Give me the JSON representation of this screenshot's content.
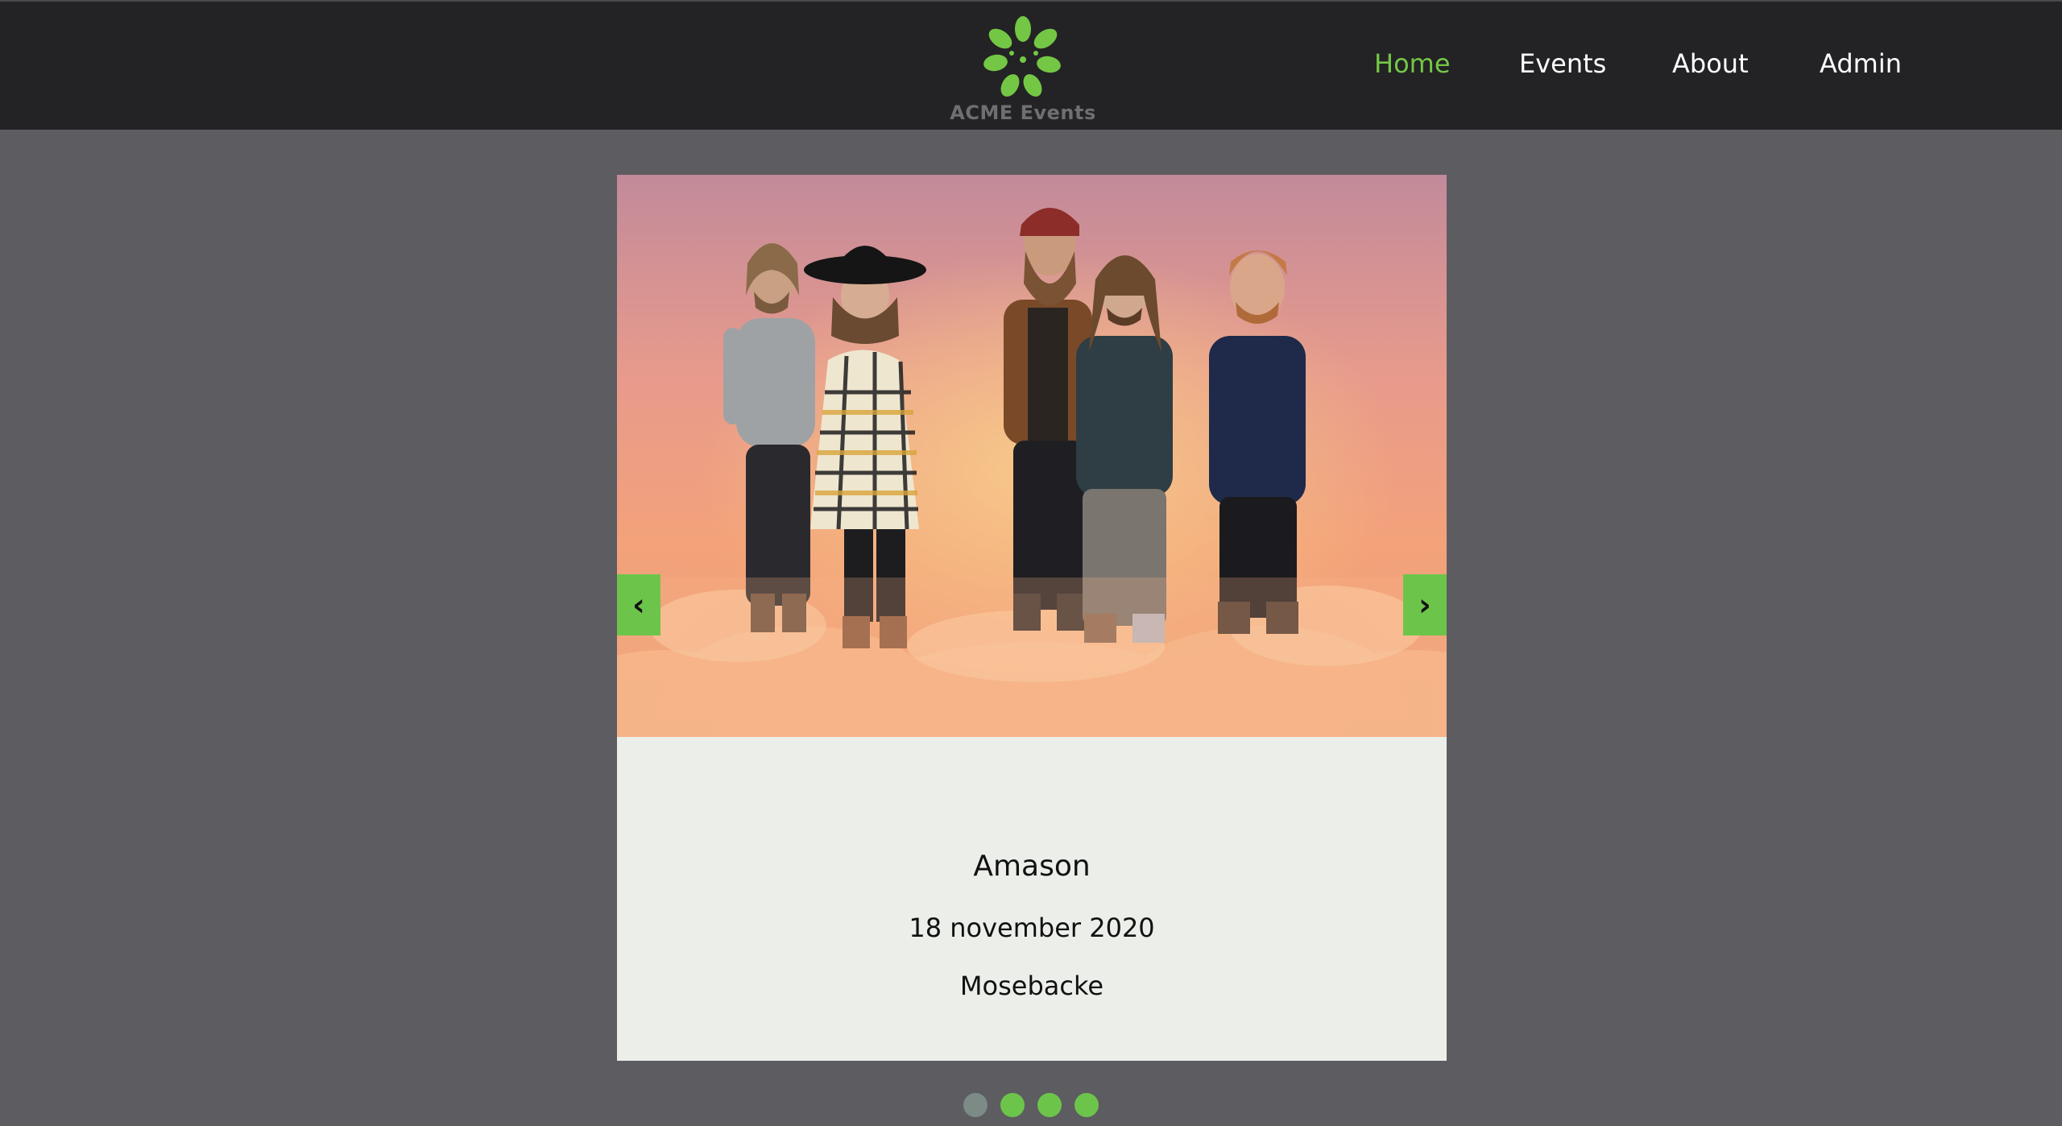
{
  "brand": {
    "name": "ACME Events",
    "logo_icon": "flower-logo-icon",
    "accent_color": "#74c745"
  },
  "nav": {
    "items": [
      {
        "label": "Home",
        "active": true
      },
      {
        "label": "Events",
        "active": false
      },
      {
        "label": "About",
        "active": false
      },
      {
        "label": "Admin",
        "active": false
      }
    ]
  },
  "carousel": {
    "prev_label": "‹",
    "next_label": "›",
    "current_slide": 1,
    "slide_count": 4,
    "slide": {
      "image_alt": "band-photo",
      "name": "Amason",
      "date": "18 november 2020",
      "venue": "Mosebacke"
    }
  }
}
